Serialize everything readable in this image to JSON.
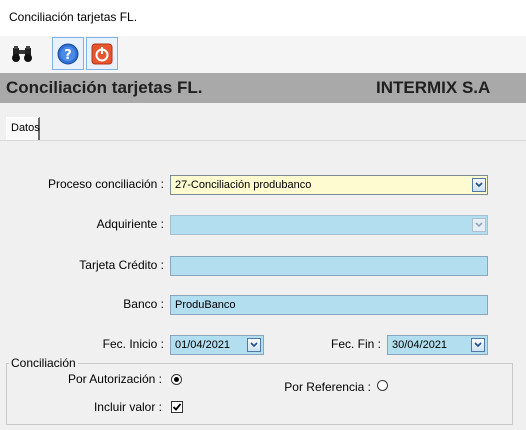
{
  "window": {
    "title": "Conciliación tarjetas FL."
  },
  "toolbar": {
    "buttons": [
      "binoculars-icon",
      "help-icon",
      "power-icon"
    ]
  },
  "header": {
    "title": "Conciliación tarjetas FL.",
    "company": "INTERMIX S.A"
  },
  "tabs": [
    {
      "label": "Datos"
    }
  ],
  "form": {
    "proceso": {
      "label": "Proceso conciliación :",
      "value": "27-Conciliación produbanco"
    },
    "adquiriente": {
      "label": "Adquiriente :",
      "value": ""
    },
    "tarjeta": {
      "label": "Tarjeta Crédito :",
      "value": ""
    },
    "banco": {
      "label": "Banco :",
      "value": "ProduBanco"
    },
    "fec_inicio": {
      "label": "Fec. Inicio :",
      "value": "01/04/2021"
    },
    "fec_fin": {
      "label": "Fec. Fin :",
      "value": "30/04/2021"
    }
  },
  "conciliacion": {
    "legend": "Conciliación",
    "por_autorizacion": {
      "label": "Por Autorización :",
      "selected": true
    },
    "por_referencia": {
      "label": "Por Referencia :",
      "selected": false
    },
    "incluir_valor": {
      "label": "Incluir valor :",
      "checked": true
    }
  },
  "colors": {
    "header_bg": "#a9a9a9",
    "field_bg": "#b2def0",
    "selected_field_bg": "#fdfbcf"
  }
}
